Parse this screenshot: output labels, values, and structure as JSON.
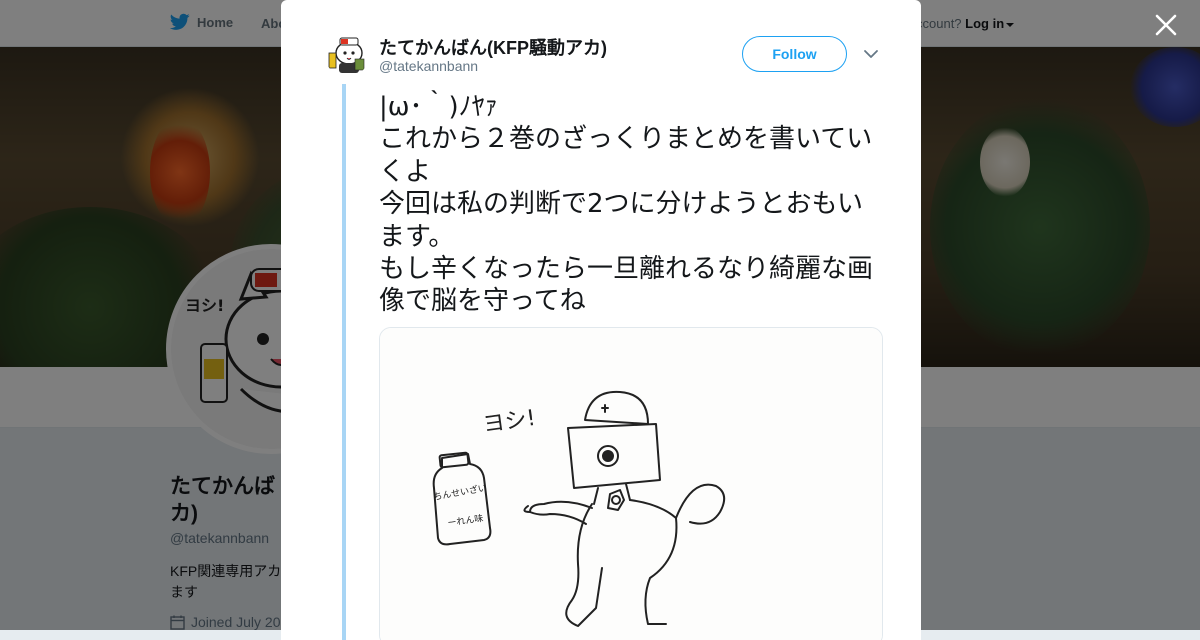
{
  "background": {
    "nav": {
      "home_label": "Home",
      "about_label": "Abo",
      "account_text": "ccount?",
      "login_label": "Log in"
    },
    "profile": {
      "name": "たてかんば\nカ)",
      "handle": "@tatekannbann",
      "bio": "KFP関連専用アカ\nます",
      "joined": "Joined July 20"
    },
    "avatar_text": "ヨシ!"
  },
  "modal": {
    "author": {
      "name": "たてかんばん(KFP騒動アカ)",
      "handle": "@tatekannbann"
    },
    "follow_label": "Follow",
    "tweet_text": "|ω･｀)ﾉﾔｧ\nこれから２巻のざっくりまとめを書いていくよ\n今回は私の判断で2つに分けようとおもいます。\nもし辛くなったら一旦離れるなり綺麗な画像で脳を守ってね",
    "image": {
      "speech_text": "ヨシ!",
      "bottle_text_1": "ちんせいざい",
      "bottle_text_2": "ーれん味"
    }
  },
  "colors": {
    "brand": "#1da1f2",
    "thread_line": "#a8d5f5",
    "text": "#14171a",
    "secondary": "#657786"
  },
  "icons": [
    "twitter-bird-icon",
    "close-icon",
    "chevron-down-icon",
    "calendar-icon"
  ]
}
